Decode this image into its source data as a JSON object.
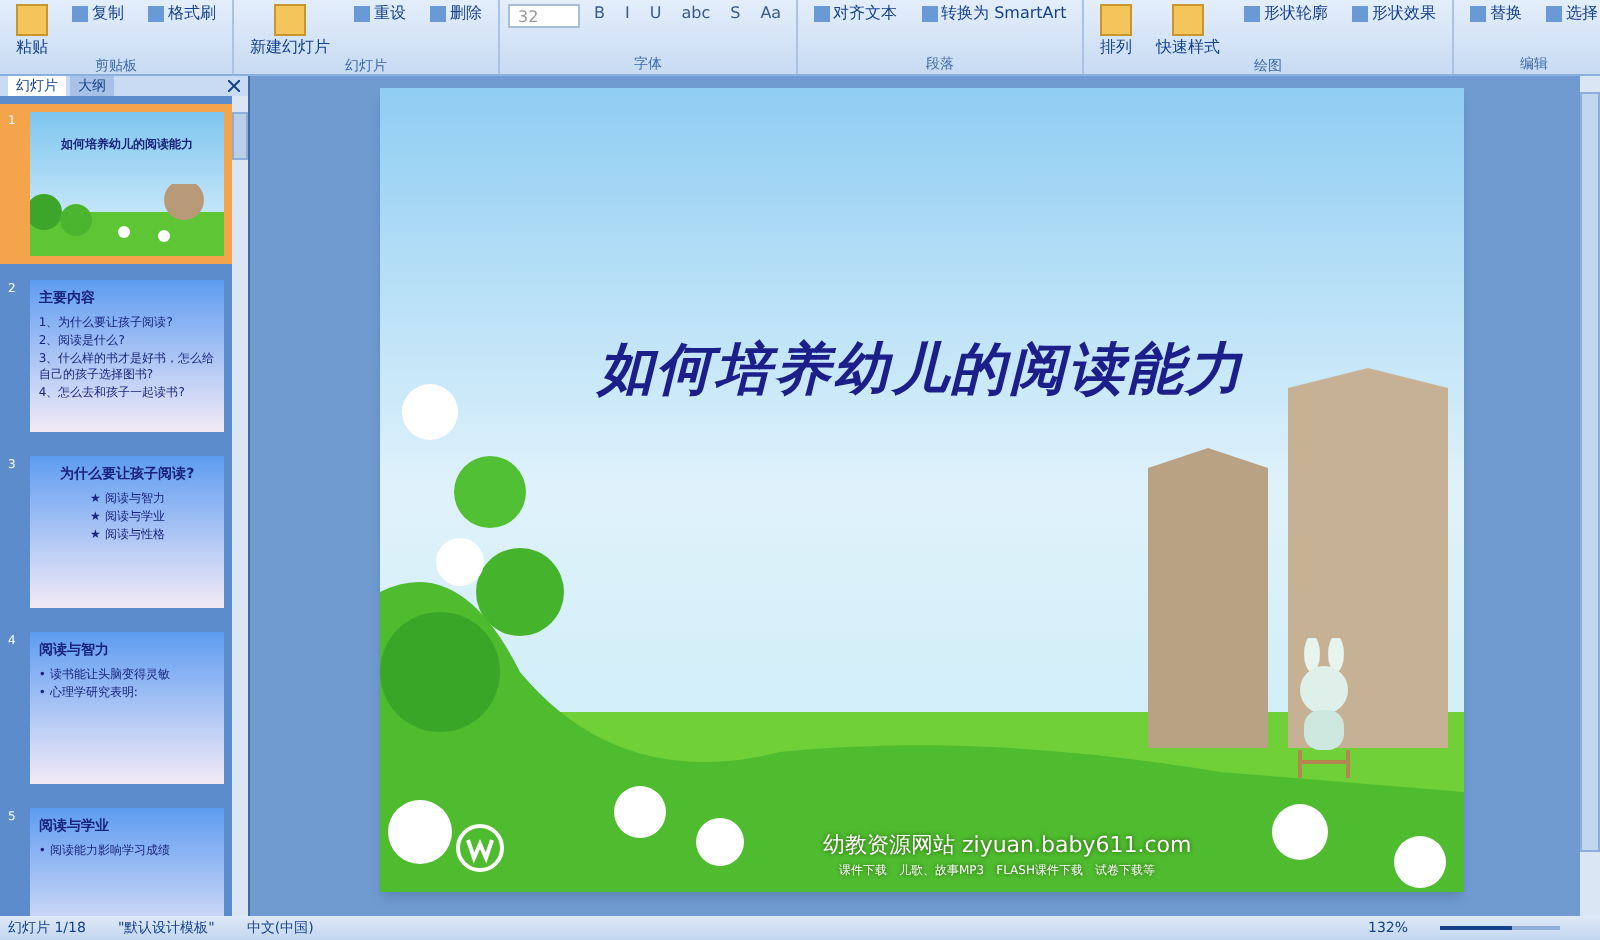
{
  "ribbon": {
    "groups": [
      {
        "label": "剪贴板",
        "items": [
          {
            "kind": "large",
            "label": "粘贴"
          },
          {
            "kind": "small",
            "label": "复制"
          },
          {
            "kind": "small",
            "label": "格式刷"
          }
        ]
      },
      {
        "label": "幻灯片",
        "items": [
          {
            "kind": "large",
            "label": "新建幻灯片"
          },
          {
            "kind": "small",
            "label": "重设"
          },
          {
            "kind": "small",
            "label": "删除"
          }
        ]
      },
      {
        "label": "字体",
        "items": [
          {
            "kind": "field",
            "label": "32"
          },
          {
            "kind": "format",
            "label": "B"
          },
          {
            "kind": "format",
            "label": "I"
          },
          {
            "kind": "format",
            "label": "U"
          },
          {
            "kind": "format",
            "label": "abc"
          },
          {
            "kind": "format",
            "label": "S"
          },
          {
            "kind": "format",
            "label": "Aa"
          }
        ]
      },
      {
        "label": "段落",
        "items": [
          {
            "kind": "small",
            "label": "对齐文本"
          },
          {
            "kind": "small",
            "label": "转换为 SmartArt"
          }
        ]
      },
      {
        "label": "绘图",
        "items": [
          {
            "kind": "large",
            "label": "排列"
          },
          {
            "kind": "large",
            "label": "快速样式"
          },
          {
            "kind": "small",
            "label": "形状轮廓"
          },
          {
            "kind": "small",
            "label": "形状效果"
          }
        ]
      },
      {
        "label": "编辑",
        "items": [
          {
            "kind": "small",
            "label": "替换"
          },
          {
            "kind": "small",
            "label": "选择"
          }
        ]
      }
    ]
  },
  "panel": {
    "tabs": [
      {
        "label": "幻灯片",
        "selected": true
      },
      {
        "label": "大纲",
        "selected": false
      }
    ],
    "thumbnails": [
      {
        "number": "1",
        "selected": true,
        "kind": "cover",
        "title": "如何培养幼儿的阅读能力"
      },
      {
        "number": "2",
        "selected": false,
        "kind": "list",
        "title": "主要内容",
        "lines": [
          "1、为什么要让孩子阅读?",
          "2、阅读是什么?",
          "3、什么样的书才是好书，怎么给自己的孩子选择图书?",
          "4、怎么去和孩子一起读书?"
        ]
      },
      {
        "number": "3",
        "selected": false,
        "kind": "stars",
        "title": "为什么要让孩子阅读?",
        "lines": [
          "★ 阅读与智力",
          "★ 阅读与学业",
          "★ 阅读与性格"
        ]
      },
      {
        "number": "4",
        "selected": false,
        "kind": "list",
        "title": "阅读与智力",
        "lines": [
          "• 读书能让头脑变得灵敏",
          "• 心理学研究表明:"
        ]
      },
      {
        "number": "5",
        "selected": false,
        "kind": "list",
        "title": "阅读与学业",
        "lines": [
          "• 阅读能力影响学习成绩"
        ]
      }
    ]
  },
  "slide": {
    "title": "如何培养幼儿的阅读能力",
    "site": "幼教资源网站 ziyuan.baby611.com",
    "links": "课件下载　儿歌、故事MP3　FLASH课件下载　试卷下载等"
  },
  "status_bar": {
    "slide_counter": "幻灯片 1/18",
    "theme": "\"默认设计模板\"",
    "language": "中文(中国)",
    "zoom": "132%",
    "zoom_slider": {
      "level": 0.6
    }
  }
}
